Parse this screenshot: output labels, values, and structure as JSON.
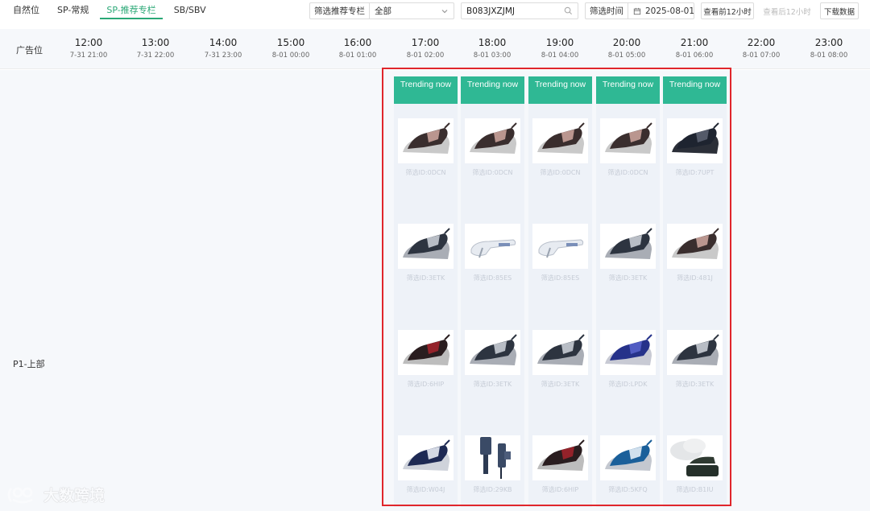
{
  "tabs": [
    {
      "label": "自然位",
      "active": false
    },
    {
      "label": "SP-常规",
      "active": false
    },
    {
      "label": "SP-推荐专栏",
      "active": true
    },
    {
      "label": "SB/SBV",
      "active": false
    }
  ],
  "filter_recommend": {
    "label": "筛选推荐专栏",
    "value": "全部"
  },
  "search": {
    "value": "B083JXZJMJ"
  },
  "filter_time": {
    "label": "筛选时间",
    "value": "2025-08-01"
  },
  "buttons": {
    "prev12": "查看前12小时",
    "next12": "查看后12小时",
    "download": "下载数据"
  },
  "header": {
    "corner_label": "广告位"
  },
  "hours": [
    {
      "time": "12:00",
      "date": "7-31 21:00"
    },
    {
      "time": "13:00",
      "date": "7-31 22:00"
    },
    {
      "time": "14:00",
      "date": "7-31 23:00"
    },
    {
      "time": "15:00",
      "date": "8-01 00:00"
    },
    {
      "time": "16:00",
      "date": "8-01 01:00"
    },
    {
      "time": "17:00",
      "date": "8-01 02:00"
    },
    {
      "time": "18:00",
      "date": "8-01 03:00"
    },
    {
      "time": "19:00",
      "date": "8-01 04:00"
    },
    {
      "time": "20:00",
      "date": "8-01 05:00"
    },
    {
      "time": "21:00",
      "date": "8-01 06:00"
    },
    {
      "time": "22:00",
      "date": "8-01 07:00"
    },
    {
      "time": "23:00",
      "date": "8-01 08:00"
    }
  ],
  "row_label": "P1-上部",
  "columns": [
    {
      "header": "Trending now",
      "items": [
        {
          "caption": "筛选ID:0DCN",
          "icon": "iron-rosegold"
        },
        {
          "caption": "筛选ID:3ETK",
          "icon": "iron-silver"
        },
        {
          "caption": "筛选ID:6HIP",
          "icon": "iron-red"
        },
        {
          "caption": "筛选ID:W04J",
          "icon": "iron-navy"
        }
      ]
    },
    {
      "header": "Trending now",
      "items": [
        {
          "caption": "筛选ID:0DCN",
          "icon": "iron-rosegold"
        },
        {
          "caption": "筛选ID:85ES",
          "icon": "steamer-white"
        },
        {
          "caption": "筛选ID:3ETK",
          "icon": "iron-silver"
        },
        {
          "caption": "筛选ID:29KB",
          "icon": "steamer-handheld"
        }
      ]
    },
    {
      "header": "Trending now",
      "items": [
        {
          "caption": "筛选ID:0DCN",
          "icon": "iron-rosegold"
        },
        {
          "caption": "筛选ID:85ES",
          "icon": "steamer-white"
        },
        {
          "caption": "筛选ID:3ETK",
          "icon": "iron-silver"
        },
        {
          "caption": "筛选ID:6HIP",
          "icon": "iron-red"
        }
      ]
    },
    {
      "header": "Trending now",
      "items": [
        {
          "caption": "筛选ID:0DCN",
          "icon": "iron-rosegold"
        },
        {
          "caption": "筛选ID:3ETK",
          "icon": "iron-silver"
        },
        {
          "caption": "筛选ID:LPDK",
          "icon": "iron-blue"
        },
        {
          "caption": "筛选ID:5KFQ",
          "icon": "iron-cyan"
        }
      ]
    },
    {
      "header": "Trending now",
      "items": [
        {
          "caption": "筛选ID:7UPT",
          "icon": "iron-station"
        },
        {
          "caption": "筛选ID:481J",
          "icon": "iron-rosegold"
        },
        {
          "caption": "筛选ID:3ETK",
          "icon": "iron-silver"
        },
        {
          "caption": "筛选ID:B1IU",
          "icon": "steam-station"
        }
      ]
    }
  ],
  "watermark": {
    "text": "大数跨境"
  },
  "colors": {
    "accent": "#2aa876",
    "trending_header": "#2fb894",
    "highlight_border": "#e0262b"
  }
}
